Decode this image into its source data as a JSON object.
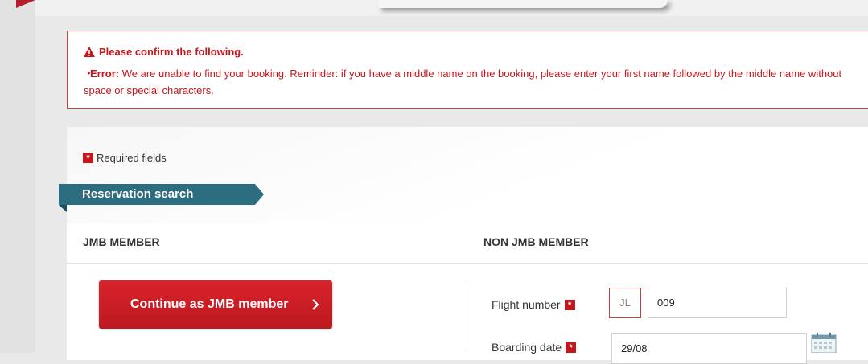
{
  "alert": {
    "title": "Please confirm the following.",
    "bullet": "・",
    "error_label": "Error:",
    "error_message": " We are unable to find your booking. Reminder: if you have a middle name on the booking, please enter your first name followed by the middle name without space or special characters."
  },
  "form": {
    "required_star": "*",
    "required_note": "Required fields",
    "section_title": "Reservation search",
    "jmb_heading": "JMB MEMBER",
    "non_jmb_heading": "NON JMB MEMBER",
    "jmb_button_label": "Continue as JMB member",
    "flight_number_label": "Flight number",
    "airline_prefix": "JL",
    "flight_number_value": "009",
    "boarding_date_label": "Boarding date",
    "boarding_date_value": "29/08"
  },
  "colors": {
    "error_red": "#c4171d",
    "ribbon_teal": "#2c6d80",
    "button_red": "#d8232b"
  },
  "icons": [
    "warning-icon",
    "chevron-right-icon",
    "calendar-icon"
  ]
}
